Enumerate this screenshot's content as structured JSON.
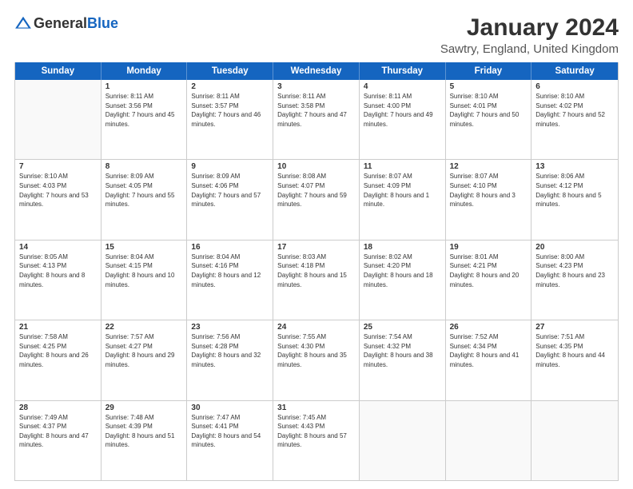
{
  "logo": {
    "general": "General",
    "blue": "Blue"
  },
  "title": "January 2024",
  "subtitle": "Sawtry, England, United Kingdom",
  "weekdays": [
    "Sunday",
    "Monday",
    "Tuesday",
    "Wednesday",
    "Thursday",
    "Friday",
    "Saturday"
  ],
  "rows": [
    [
      {
        "day": "",
        "sunrise": "",
        "sunset": "",
        "daylight": ""
      },
      {
        "day": "1",
        "sunrise": "Sunrise: 8:11 AM",
        "sunset": "Sunset: 3:56 PM",
        "daylight": "Daylight: 7 hours and 45 minutes."
      },
      {
        "day": "2",
        "sunrise": "Sunrise: 8:11 AM",
        "sunset": "Sunset: 3:57 PM",
        "daylight": "Daylight: 7 hours and 46 minutes."
      },
      {
        "day": "3",
        "sunrise": "Sunrise: 8:11 AM",
        "sunset": "Sunset: 3:58 PM",
        "daylight": "Daylight: 7 hours and 47 minutes."
      },
      {
        "day": "4",
        "sunrise": "Sunrise: 8:11 AM",
        "sunset": "Sunset: 4:00 PM",
        "daylight": "Daylight: 7 hours and 49 minutes."
      },
      {
        "day": "5",
        "sunrise": "Sunrise: 8:10 AM",
        "sunset": "Sunset: 4:01 PM",
        "daylight": "Daylight: 7 hours and 50 minutes."
      },
      {
        "day": "6",
        "sunrise": "Sunrise: 8:10 AM",
        "sunset": "Sunset: 4:02 PM",
        "daylight": "Daylight: 7 hours and 52 minutes."
      }
    ],
    [
      {
        "day": "7",
        "sunrise": "Sunrise: 8:10 AM",
        "sunset": "Sunset: 4:03 PM",
        "daylight": "Daylight: 7 hours and 53 minutes."
      },
      {
        "day": "8",
        "sunrise": "Sunrise: 8:09 AM",
        "sunset": "Sunset: 4:05 PM",
        "daylight": "Daylight: 7 hours and 55 minutes."
      },
      {
        "day": "9",
        "sunrise": "Sunrise: 8:09 AM",
        "sunset": "Sunset: 4:06 PM",
        "daylight": "Daylight: 7 hours and 57 minutes."
      },
      {
        "day": "10",
        "sunrise": "Sunrise: 8:08 AM",
        "sunset": "Sunset: 4:07 PM",
        "daylight": "Daylight: 7 hours and 59 minutes."
      },
      {
        "day": "11",
        "sunrise": "Sunrise: 8:07 AM",
        "sunset": "Sunset: 4:09 PM",
        "daylight": "Daylight: 8 hours and 1 minute."
      },
      {
        "day": "12",
        "sunrise": "Sunrise: 8:07 AM",
        "sunset": "Sunset: 4:10 PM",
        "daylight": "Daylight: 8 hours and 3 minutes."
      },
      {
        "day": "13",
        "sunrise": "Sunrise: 8:06 AM",
        "sunset": "Sunset: 4:12 PM",
        "daylight": "Daylight: 8 hours and 5 minutes."
      }
    ],
    [
      {
        "day": "14",
        "sunrise": "Sunrise: 8:05 AM",
        "sunset": "Sunset: 4:13 PM",
        "daylight": "Daylight: 8 hours and 8 minutes."
      },
      {
        "day": "15",
        "sunrise": "Sunrise: 8:04 AM",
        "sunset": "Sunset: 4:15 PM",
        "daylight": "Daylight: 8 hours and 10 minutes."
      },
      {
        "day": "16",
        "sunrise": "Sunrise: 8:04 AM",
        "sunset": "Sunset: 4:16 PM",
        "daylight": "Daylight: 8 hours and 12 minutes."
      },
      {
        "day": "17",
        "sunrise": "Sunrise: 8:03 AM",
        "sunset": "Sunset: 4:18 PM",
        "daylight": "Daylight: 8 hours and 15 minutes."
      },
      {
        "day": "18",
        "sunrise": "Sunrise: 8:02 AM",
        "sunset": "Sunset: 4:20 PM",
        "daylight": "Daylight: 8 hours and 18 minutes."
      },
      {
        "day": "19",
        "sunrise": "Sunrise: 8:01 AM",
        "sunset": "Sunset: 4:21 PM",
        "daylight": "Daylight: 8 hours and 20 minutes."
      },
      {
        "day": "20",
        "sunrise": "Sunrise: 8:00 AM",
        "sunset": "Sunset: 4:23 PM",
        "daylight": "Daylight: 8 hours and 23 minutes."
      }
    ],
    [
      {
        "day": "21",
        "sunrise": "Sunrise: 7:58 AM",
        "sunset": "Sunset: 4:25 PM",
        "daylight": "Daylight: 8 hours and 26 minutes."
      },
      {
        "day": "22",
        "sunrise": "Sunrise: 7:57 AM",
        "sunset": "Sunset: 4:27 PM",
        "daylight": "Daylight: 8 hours and 29 minutes."
      },
      {
        "day": "23",
        "sunrise": "Sunrise: 7:56 AM",
        "sunset": "Sunset: 4:28 PM",
        "daylight": "Daylight: 8 hours and 32 minutes."
      },
      {
        "day": "24",
        "sunrise": "Sunrise: 7:55 AM",
        "sunset": "Sunset: 4:30 PM",
        "daylight": "Daylight: 8 hours and 35 minutes."
      },
      {
        "day": "25",
        "sunrise": "Sunrise: 7:54 AM",
        "sunset": "Sunset: 4:32 PM",
        "daylight": "Daylight: 8 hours and 38 minutes."
      },
      {
        "day": "26",
        "sunrise": "Sunrise: 7:52 AM",
        "sunset": "Sunset: 4:34 PM",
        "daylight": "Daylight: 8 hours and 41 minutes."
      },
      {
        "day": "27",
        "sunrise": "Sunrise: 7:51 AM",
        "sunset": "Sunset: 4:35 PM",
        "daylight": "Daylight: 8 hours and 44 minutes."
      }
    ],
    [
      {
        "day": "28",
        "sunrise": "Sunrise: 7:49 AM",
        "sunset": "Sunset: 4:37 PM",
        "daylight": "Daylight: 8 hours and 47 minutes."
      },
      {
        "day": "29",
        "sunrise": "Sunrise: 7:48 AM",
        "sunset": "Sunset: 4:39 PM",
        "daylight": "Daylight: 8 hours and 51 minutes."
      },
      {
        "day": "30",
        "sunrise": "Sunrise: 7:47 AM",
        "sunset": "Sunset: 4:41 PM",
        "daylight": "Daylight: 8 hours and 54 minutes."
      },
      {
        "day": "31",
        "sunrise": "Sunrise: 7:45 AM",
        "sunset": "Sunset: 4:43 PM",
        "daylight": "Daylight: 8 hours and 57 minutes."
      },
      {
        "day": "",
        "sunrise": "",
        "sunset": "",
        "daylight": ""
      },
      {
        "day": "",
        "sunrise": "",
        "sunset": "",
        "daylight": ""
      },
      {
        "day": "",
        "sunrise": "",
        "sunset": "",
        "daylight": ""
      }
    ]
  ]
}
